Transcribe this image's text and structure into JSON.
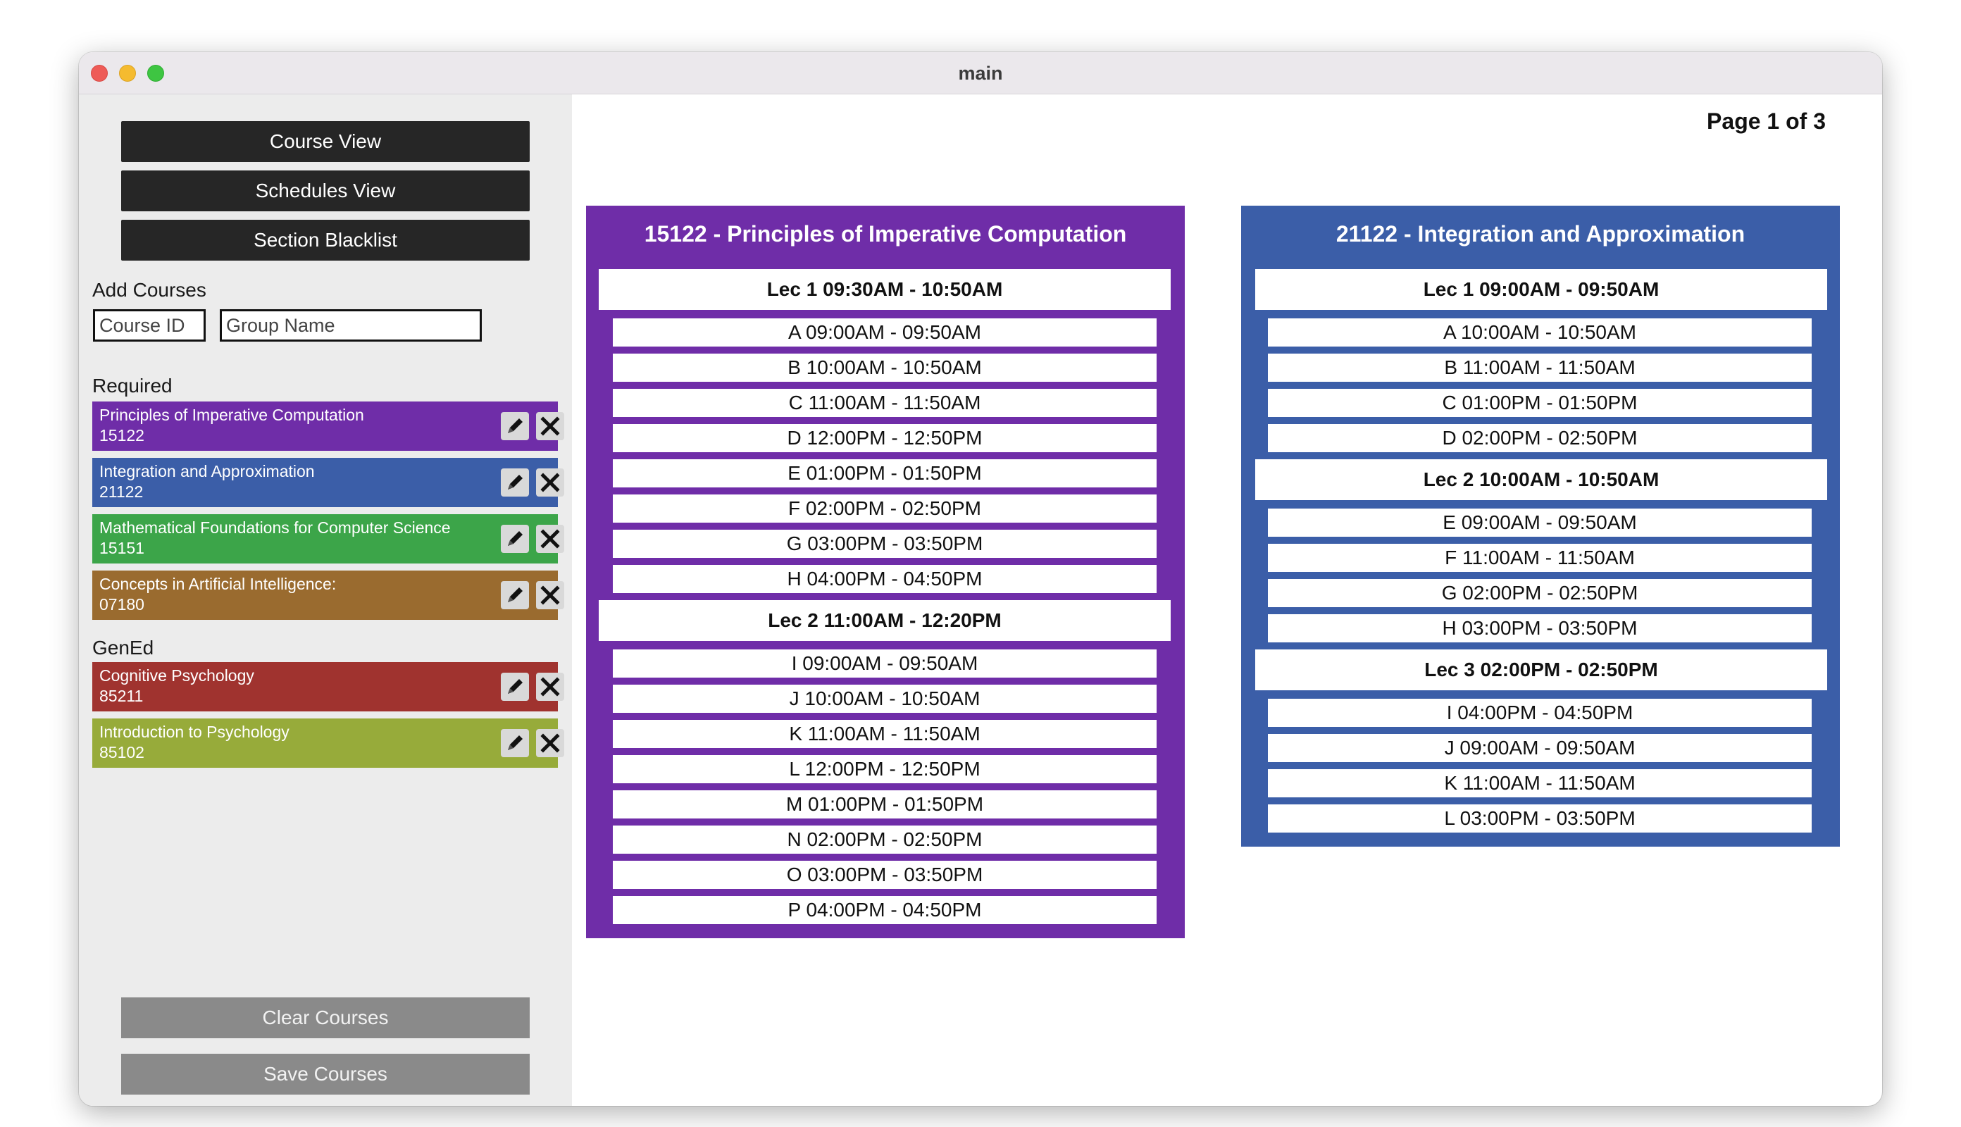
{
  "window": {
    "title": "main"
  },
  "nav": {
    "course_view": "Course View",
    "schedules_view": "Schedules View",
    "section_blacklist": "Section Blacklist"
  },
  "add_courses": {
    "label": "Add Courses",
    "course_id_placeholder": "Course ID",
    "group_name_placeholder": "Group Name"
  },
  "groups": [
    {
      "label": "Required",
      "courses": [
        {
          "name": "Principles of Imperative Computation",
          "id": "15122",
          "color": "#6f2da8"
        },
        {
          "name": "Integration and Approximation",
          "id": "21122",
          "color": "#3b5ea8"
        },
        {
          "name": "Mathematical Foundations for Computer Science",
          "id": "15151",
          "color": "#3ca549"
        },
        {
          "name": "Concepts in Artificial Intelligence:",
          "id": "07180",
          "color": "#9a6b2f"
        }
      ]
    },
    {
      "label": "GenEd",
      "courses": [
        {
          "name": "Cognitive Psychology",
          "id": "85211",
          "color": "#a0332f"
        },
        {
          "name": "Introduction to Psychology",
          "id": "85102",
          "color": "#97ab3a"
        }
      ]
    }
  ],
  "actions": {
    "clear": "Clear Courses",
    "save": "Save Courses"
  },
  "pagination": {
    "label": "Page 1 of 3"
  },
  "schedules": [
    {
      "title": "15122 - Principles of Imperative Computation",
      "color": "#6f2da8",
      "lectures": [
        {
          "label": "Lec 1 09:30AM - 10:50AM",
          "sections": [
            "A 09:00AM - 09:50AM",
            "B 10:00AM - 10:50AM",
            "C 11:00AM - 11:50AM",
            "D 12:00PM - 12:50PM",
            "E 01:00PM - 01:50PM",
            "F 02:00PM - 02:50PM",
            "G 03:00PM - 03:50PM",
            "H 04:00PM - 04:50PM"
          ]
        },
        {
          "label": "Lec 2 11:00AM - 12:20PM",
          "sections": [
            "I 09:00AM - 09:50AM",
            "J 10:00AM - 10:50AM",
            "K 11:00AM - 11:50AM",
            "L 12:00PM - 12:50PM",
            "M 01:00PM - 01:50PM",
            "N 02:00PM - 02:50PM",
            "O 03:00PM - 03:50PM",
            "P 04:00PM - 04:50PM"
          ]
        }
      ]
    },
    {
      "title": "21122 - Integration and Approximation",
      "color": "#3b5ea8",
      "lectures": [
        {
          "label": "Lec 1 09:00AM - 09:50AM",
          "sections": [
            "A 10:00AM - 10:50AM",
            "B 11:00AM - 11:50AM",
            "C 01:00PM - 01:50PM",
            "D 02:00PM - 02:50PM"
          ]
        },
        {
          "label": "Lec 2 10:00AM - 10:50AM",
          "sections": [
            "E 09:00AM - 09:50AM",
            "F 11:00AM - 11:50AM",
            "G 02:00PM - 02:50PM",
            "H 03:00PM - 03:50PM"
          ]
        },
        {
          "label": "Lec 3 02:00PM - 02:50PM",
          "sections": [
            "I 04:00PM - 04:50PM",
            "J 09:00AM - 09:50AM",
            "K 11:00AM - 11:50AM",
            "L 03:00PM - 03:50PM"
          ]
        }
      ]
    }
  ]
}
